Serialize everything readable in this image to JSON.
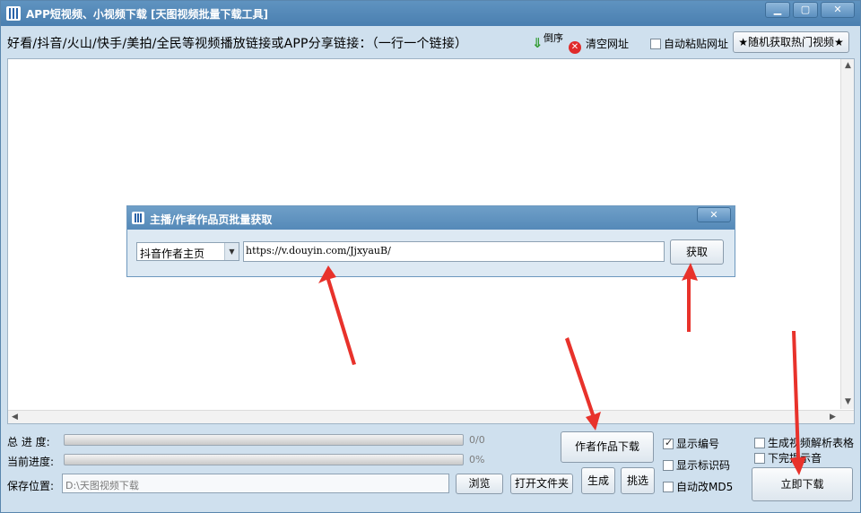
{
  "window": {
    "title": "APP短视频、小视频下载 [天图视频批量下载工具]",
    "minimize_label": "▁",
    "maximize_label": "▢",
    "close_label": "✕"
  },
  "toolbar": {
    "prompt": "好看/抖音/火山/快手/美拍/全民等视频播放链接或APP分享链接：（一行一个链接）",
    "reverse_label": "倒序",
    "reverse_icon": "down-arrow-icon",
    "clear_label": "清空网址",
    "auto_paste_label": "自动粘贴网址",
    "auto_paste_checked": false,
    "random_hot_label": "★随机获取热门视频★"
  },
  "links_area": {
    "value": ""
  },
  "dialog": {
    "title": "主播/作者作品页批量获取",
    "close_label": "✕",
    "source_selected": "抖音作者主页",
    "url_value": "https://v.douyin.com/JjxyauB/",
    "fetch_label": "获取"
  },
  "progress": {
    "total_label": "总 进 度:",
    "total_text": "0/0",
    "total_fraction": 0,
    "current_label": "当前进度:",
    "current_text": "0%",
    "current_fraction": 0
  },
  "save": {
    "label": "保存位置:",
    "path": "D:\\天图视频下载",
    "browse_label": "浏览",
    "open_folder_label": "打开文件夹"
  },
  "actions": {
    "author_download_label": "作者作品下载",
    "generate_label": "生成",
    "pick_label": "挑选",
    "download_now_label": "立即下载"
  },
  "options": {
    "show_number_label": "显示编号",
    "show_number_checked": true,
    "show_id_label": "显示标识码",
    "show_id_checked": false,
    "auto_md5_label": "自动改MD5",
    "auto_md5_checked": false,
    "gen_table_label": "生成视频解析表格",
    "gen_table_checked": false,
    "done_sound_label": "下完提示音",
    "done_sound_checked": false
  },
  "colors": {
    "titlebar": "#4f84b4",
    "window_bg": "#cfe0ee",
    "annotation_arrow": "#e8322b"
  }
}
